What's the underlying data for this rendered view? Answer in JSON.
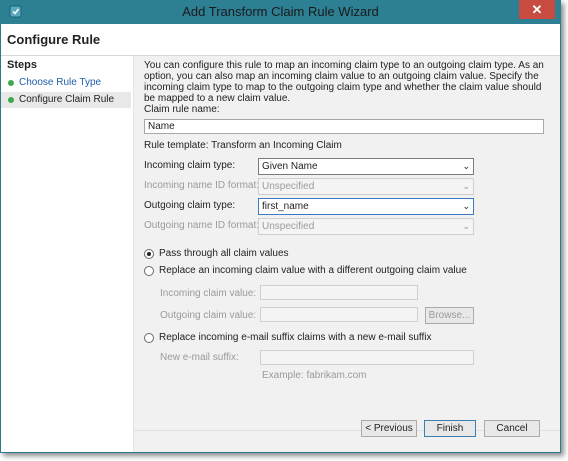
{
  "window": {
    "title": "Add Transform Claim Rule Wizard",
    "close_glyph": "✕"
  },
  "header": {
    "title": "Configure Rule"
  },
  "steps": {
    "title": "Steps",
    "items": [
      {
        "label": "Choose Rule Type"
      },
      {
        "label": "Configure Claim Rule"
      }
    ]
  },
  "content": {
    "description": "You can configure this rule to map an incoming claim type to an outgoing claim type. As an option, you can also map an incoming claim value to an outgoing claim value. Specify the incoming claim type to map to the outgoing claim type and whether the claim value should be mapped to a new claim value.",
    "claim_rule_name_label": "Claim rule name:",
    "claim_rule_name_value": "Name",
    "rule_template": "Rule template: Transform an Incoming Claim",
    "incoming_claim_type_label": "Incoming claim type:",
    "incoming_claim_type_value": "Given Name",
    "incoming_name_id_label": "Incoming name ID format:",
    "incoming_name_id_value": "Unspecified",
    "outgoing_claim_type_label": "Outgoing claim type:",
    "outgoing_claim_type_value": "first_name",
    "outgoing_name_id_label": "Outgoing name ID format:",
    "outgoing_name_id_value": "Unspecified",
    "radio_pass_through": "Pass through all claim values",
    "radio_replace_value": "Replace an incoming claim value with a different outgoing claim value",
    "incoming_claim_value_label": "Incoming claim value:",
    "outgoing_claim_value_label": "Outgoing claim value:",
    "browse_label": "Browse...",
    "radio_replace_email": "Replace incoming e-mail suffix claims with a new e-mail suffix",
    "new_email_suffix_label": "New e-mail suffix:",
    "email_example": "Example: fabrikam.com"
  },
  "buttons": {
    "previous": "< Previous",
    "finish": "Finish",
    "cancel": "Cancel"
  },
  "icons": {
    "dropdown_arrow": "⌄"
  },
  "colors": {
    "title_bar": "#2d7f94",
    "close": "#c74b40",
    "step_dot": "#3aaa4a",
    "link": "#1f5fa8"
  }
}
